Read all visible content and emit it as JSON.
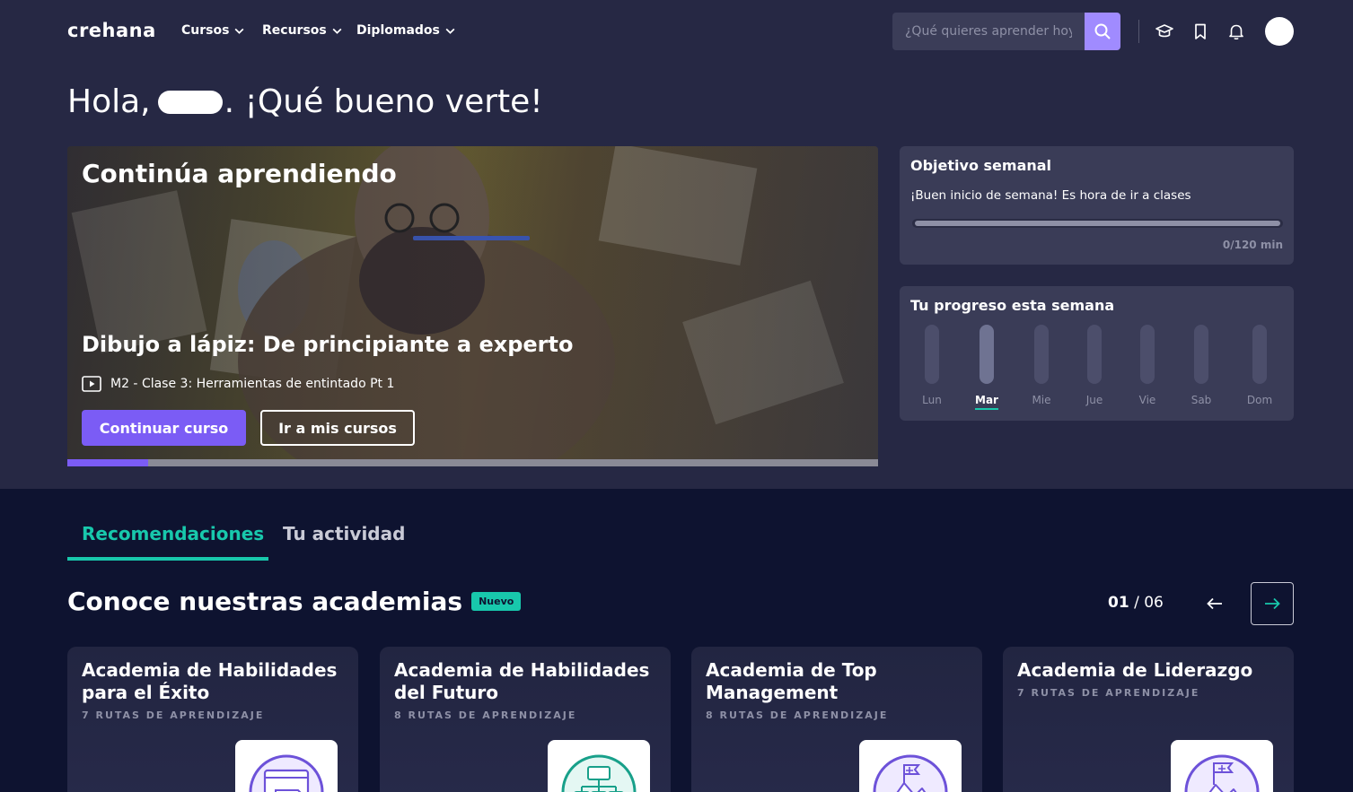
{
  "nav": {
    "logo": "crehana",
    "menu": [
      {
        "label": "Cursos"
      },
      {
        "label": "Recursos"
      },
      {
        "label": "Diplomados"
      }
    ],
    "search_placeholder": "¿Qué quieres aprender hoy?"
  },
  "greeting": {
    "hello": "Hola,",
    "suffix": ". ¡Qué bueno verte!"
  },
  "hero": {
    "title": "Continúa aprendiendo",
    "course_title": "Dibujo a lápiz: De principiante a experto",
    "lesson": "M2 - Clase 3: Herramientas de entintado Pt 1",
    "continue_label": "Continuar curso",
    "my_courses_label": "Ir a mis cursos",
    "progress_fraction": 0.1
  },
  "weekly_goal": {
    "title": "Objetivo semanal",
    "message": "¡Buen inicio de semana! Es hora de ir a clases",
    "progress_fraction": 0,
    "minutes_label": "0/120 min"
  },
  "week_progress": {
    "title": "Tu progreso esta semana",
    "days": [
      {
        "label": "Lun",
        "active": false
      },
      {
        "label": "Mar",
        "active": true
      },
      {
        "label": "Mie",
        "active": false
      },
      {
        "label": "Jue",
        "active": false
      },
      {
        "label": "Vie",
        "active": false
      },
      {
        "label": "Sab",
        "active": false
      },
      {
        "label": "Dom",
        "active": false
      }
    ]
  },
  "tabs": [
    {
      "label": "Recomendaciones",
      "active": true
    },
    {
      "label": "Tu actividad",
      "active": false
    }
  ],
  "academies_section": {
    "title": "Conoce nuestras academias",
    "badge": "Nuevo",
    "page_current": "01",
    "page_total": "/ 06"
  },
  "academies": [
    {
      "title": "Academia de Habilidades para el Éxito",
      "subtitle": "7 RUTAS DE APRENDIZAJE"
    },
    {
      "title": "Academia de Habilidades del Futuro",
      "subtitle": "8 RUTAS DE APRENDIZAJE"
    },
    {
      "title": "Academia de Top Management",
      "subtitle": "8 RUTAS DE APRENDIZAJE"
    },
    {
      "title": "Academia de Liderazgo",
      "subtitle": "7 RUTAS DE APRENDIZAJE"
    }
  ],
  "colors": {
    "accent_purple": "#7b5cf5",
    "accent_teal": "#18c8ac",
    "bg_top": "#262844",
    "bg_bottom": "#0e1330"
  }
}
